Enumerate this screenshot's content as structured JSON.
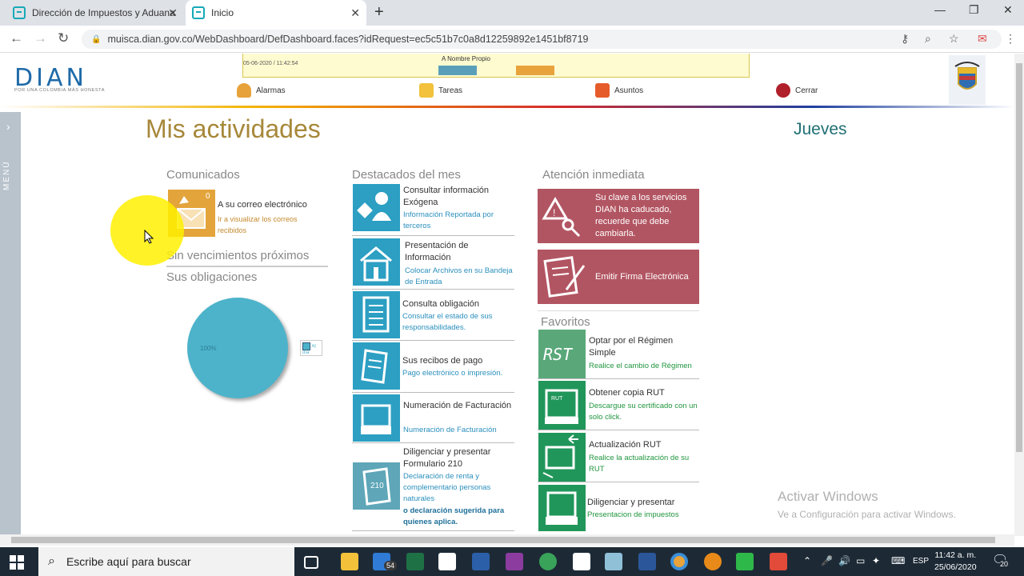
{
  "browser": {
    "tabs": [
      {
        "title": "Dirección de Impuestos y Aduana"
      },
      {
        "title": "Inicio"
      }
    ],
    "url": "muisca.dian.gov.co/WebDashboard/DefDashboard.faces?idRequest=ec5c51b7c0a8d12259892e1451bf8719"
  },
  "header": {
    "logo_text": "DIAN",
    "logo_tagline": "POR UNA COLOMBIA MÁS HONESTA",
    "banner_label": "A Nombre Propio",
    "banner_date": "05-06-2020 / 11:42:54",
    "nav": [
      {
        "label": "Alarmas",
        "color": "#e8a23a"
      },
      {
        "label": "Tareas",
        "color": "#f2c23c"
      },
      {
        "label": "Asuntos",
        "color": "#e65b2a"
      },
      {
        "label": "Cerrar",
        "color": "#b0202a"
      }
    ]
  },
  "sidemenu": {
    "label": "MENÚ"
  },
  "main": {
    "title": "Mis actividades",
    "day": "Jueves",
    "comunicados": {
      "heading": "Comunicados",
      "count": "0",
      "title": "A su correo electrónico",
      "subtitle": "Ir a visualizar los correos recibidos"
    },
    "sin_vencimientos": "Sin vencimientos próximos",
    "obligaciones": {
      "heading": "Sus obligaciones",
      "pie_label": "100%",
      "legend": "Al día"
    },
    "destacados": {
      "heading": "Destacados del mes",
      "items": [
        {
          "title": "Consultar información Exógena",
          "subtitle": "Información Reportada por terceros"
        },
        {
          "title": "Presentación de Información",
          "subtitle": "Colocar Archivos en su Bandeja de Entrada"
        },
        {
          "title": "Consulta obligación",
          "subtitle": "Consultar el estado de sus responsabilidades."
        },
        {
          "title": "Sus recibos de pago",
          "subtitle": "Pago electrónico o impresión."
        },
        {
          "title": "Numeración de Facturación",
          "subtitle": "Numeración de Facturación"
        },
        {
          "title": "Diligenciar y presentar Formulario 210",
          "subtitle": "Declaración de renta y complementario personas naturales",
          "extra": "o declaración sugerida para quienes aplica."
        }
      ]
    },
    "atencion": {
      "heading": "Atención inmediata",
      "items": [
        {
          "text": "Su clave a los servicios DIAN ha caducado, recuerde que debe cambiarla."
        },
        {
          "text": "Emitir Firma Electrónica"
        }
      ]
    },
    "favoritos": {
      "heading": "Favoritos",
      "items": [
        {
          "title": "Optar por el Régimen Simple",
          "subtitle": "Realice el cambio de Régimen"
        },
        {
          "title": "Obtener copia RUT",
          "subtitle": "Descargue su certificado con un solo click."
        },
        {
          "title": "Actualización RUT",
          "subtitle": "Realice la actualización de su RUT"
        },
        {
          "title": "Diligenciar y presentar",
          "subtitle": "Presentacion de impuestos"
        }
      ]
    },
    "watermark": {
      "title": "Activar Windows",
      "subtitle": "Ve a Configuración para activar Windows."
    }
  },
  "taskbar": {
    "search_placeholder": "Escribe aquí para buscar",
    "mail_badge": "54",
    "language": "ESP",
    "time": "11:42 a. m.",
    "date": "25/06/2020",
    "notifications": "20"
  }
}
